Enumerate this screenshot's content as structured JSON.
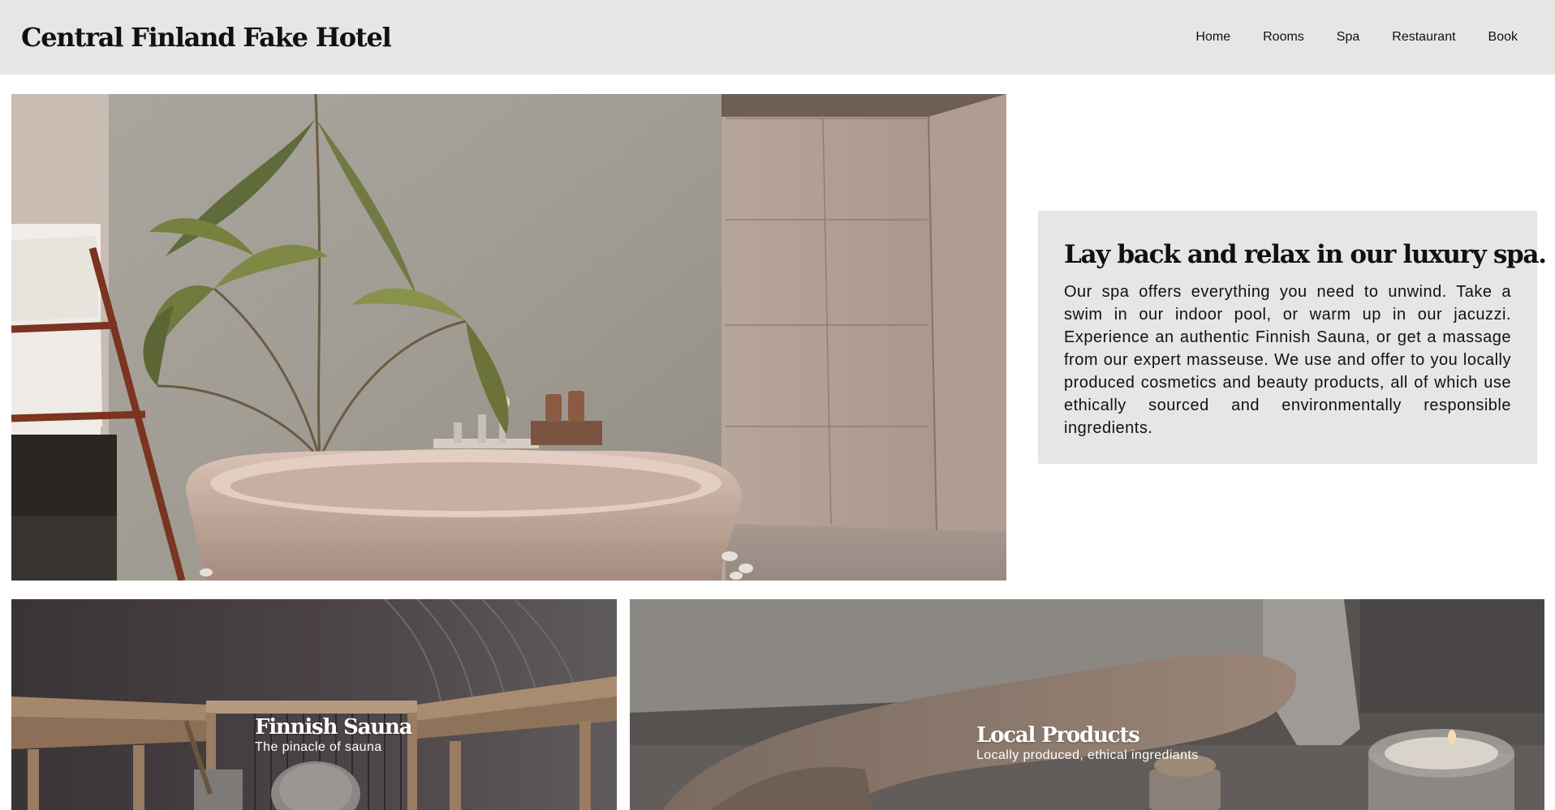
{
  "header": {
    "site_title": "Central Finland Fake Hotel",
    "nav": [
      "Home",
      "Rooms",
      "Spa",
      "Restaurant",
      "Book"
    ]
  },
  "intro": {
    "heading": "Lay back and relax in our luxury spa.",
    "body": "Our spa offers everything you need to unwind. Take a swim in our indoor pool, or warm up in our jacuzzi. Experience an authentic Finnish Sauna, or get a massage from our expert masseuse. We use and offer to you locally produced cosmetics and beauty products, all of which use ethically sourced and environmentally responsible ingredients."
  },
  "cards": [
    {
      "title": "Finnish Sauna",
      "subtitle": "The pinacle of sauna"
    },
    {
      "title": "Local Products",
      "subtitle": "Locally produced, ethical ingrediants"
    }
  ],
  "colors": {
    "header_bg": "#e7e6e4",
    "panel_bg": "#e7e6e4",
    "text": "#111111",
    "caption_text": "#ffffff"
  }
}
